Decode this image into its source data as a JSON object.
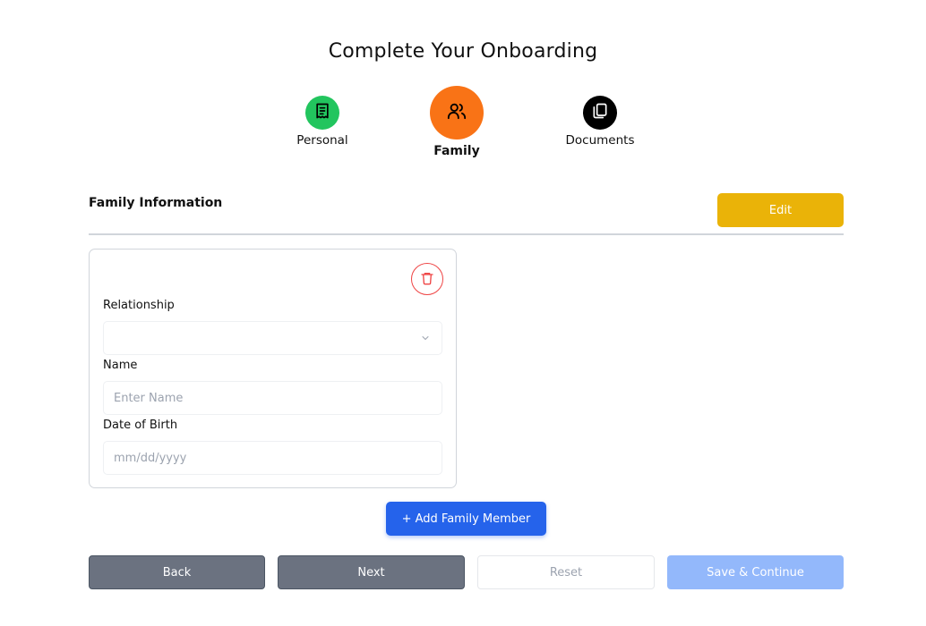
{
  "page": {
    "title": "Complete Your Onboarding"
  },
  "steps": [
    {
      "label": "Personal",
      "icon": "receipt-icon",
      "color": "#22c55e"
    },
    {
      "label": "Family",
      "icon": "users-icon",
      "color": "#f97316",
      "active": true
    },
    {
      "label": "Documents",
      "icon": "copy-icon",
      "color": "#000000"
    }
  ],
  "section": {
    "title": "Family Information",
    "edit_label": "Edit"
  },
  "member_card": {
    "delete_icon": "trash-icon",
    "relationship": {
      "label": "Relationship",
      "value": ""
    },
    "name": {
      "label": "Name",
      "placeholder": "Enter Name",
      "value": ""
    },
    "dob": {
      "label": "Date of Birth",
      "placeholder": "mm/dd/yyyy"
    }
  },
  "add_member_label": "+ Add Family Member",
  "footer": {
    "back_label": "Back",
    "next_label": "Next",
    "reset_label": "Reset",
    "save_label": "Save & Continue"
  },
  "colors": {
    "edit": "#eab308",
    "primary": "#2563eb",
    "secondary": "#6b7280",
    "save_disabled": "#93b8fb",
    "danger": "#ef4444"
  }
}
